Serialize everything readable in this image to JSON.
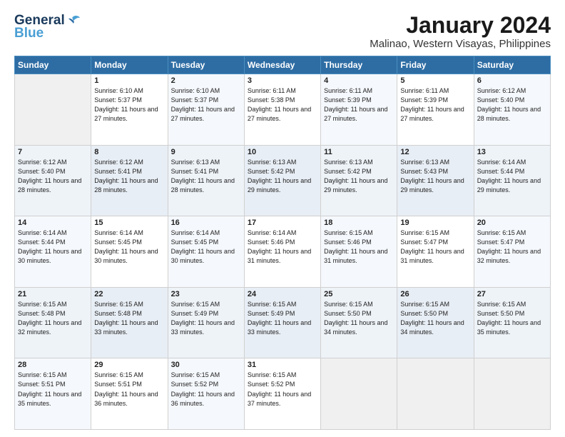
{
  "logo": {
    "line1": "General",
    "line2": "Blue"
  },
  "title": "January 2024",
  "subtitle": "Malinao, Western Visayas, Philippines",
  "weekdays": [
    "Sunday",
    "Monday",
    "Tuesday",
    "Wednesday",
    "Thursday",
    "Friday",
    "Saturday"
  ],
  "weeks": [
    [
      {
        "day": "",
        "sunrise": "",
        "sunset": "",
        "daylight": ""
      },
      {
        "day": "1",
        "sunrise": "6:10 AM",
        "sunset": "5:37 PM",
        "daylight": "11 hours and 27 minutes."
      },
      {
        "day": "2",
        "sunrise": "6:10 AM",
        "sunset": "5:37 PM",
        "daylight": "11 hours and 27 minutes."
      },
      {
        "day": "3",
        "sunrise": "6:11 AM",
        "sunset": "5:38 PM",
        "daylight": "11 hours and 27 minutes."
      },
      {
        "day": "4",
        "sunrise": "6:11 AM",
        "sunset": "5:39 PM",
        "daylight": "11 hours and 27 minutes."
      },
      {
        "day": "5",
        "sunrise": "6:11 AM",
        "sunset": "5:39 PM",
        "daylight": "11 hours and 27 minutes."
      },
      {
        "day": "6",
        "sunrise": "6:12 AM",
        "sunset": "5:40 PM",
        "daylight": "11 hours and 28 minutes."
      }
    ],
    [
      {
        "day": "7",
        "sunrise": "6:12 AM",
        "sunset": "5:40 PM",
        "daylight": "11 hours and 28 minutes."
      },
      {
        "day": "8",
        "sunrise": "6:12 AM",
        "sunset": "5:41 PM",
        "daylight": "11 hours and 28 minutes."
      },
      {
        "day": "9",
        "sunrise": "6:13 AM",
        "sunset": "5:41 PM",
        "daylight": "11 hours and 28 minutes."
      },
      {
        "day": "10",
        "sunrise": "6:13 AM",
        "sunset": "5:42 PM",
        "daylight": "11 hours and 29 minutes."
      },
      {
        "day": "11",
        "sunrise": "6:13 AM",
        "sunset": "5:42 PM",
        "daylight": "11 hours and 29 minutes."
      },
      {
        "day": "12",
        "sunrise": "6:13 AM",
        "sunset": "5:43 PM",
        "daylight": "11 hours and 29 minutes."
      },
      {
        "day": "13",
        "sunrise": "6:14 AM",
        "sunset": "5:44 PM",
        "daylight": "11 hours and 29 minutes."
      }
    ],
    [
      {
        "day": "14",
        "sunrise": "6:14 AM",
        "sunset": "5:44 PM",
        "daylight": "11 hours and 30 minutes."
      },
      {
        "day": "15",
        "sunrise": "6:14 AM",
        "sunset": "5:45 PM",
        "daylight": "11 hours and 30 minutes."
      },
      {
        "day": "16",
        "sunrise": "6:14 AM",
        "sunset": "5:45 PM",
        "daylight": "11 hours and 30 minutes."
      },
      {
        "day": "17",
        "sunrise": "6:14 AM",
        "sunset": "5:46 PM",
        "daylight": "11 hours and 31 minutes."
      },
      {
        "day": "18",
        "sunrise": "6:15 AM",
        "sunset": "5:46 PM",
        "daylight": "11 hours and 31 minutes."
      },
      {
        "day": "19",
        "sunrise": "6:15 AM",
        "sunset": "5:47 PM",
        "daylight": "11 hours and 31 minutes."
      },
      {
        "day": "20",
        "sunrise": "6:15 AM",
        "sunset": "5:47 PM",
        "daylight": "11 hours and 32 minutes."
      }
    ],
    [
      {
        "day": "21",
        "sunrise": "6:15 AM",
        "sunset": "5:48 PM",
        "daylight": "11 hours and 32 minutes."
      },
      {
        "day": "22",
        "sunrise": "6:15 AM",
        "sunset": "5:48 PM",
        "daylight": "11 hours and 33 minutes."
      },
      {
        "day": "23",
        "sunrise": "6:15 AM",
        "sunset": "5:49 PM",
        "daylight": "11 hours and 33 minutes."
      },
      {
        "day": "24",
        "sunrise": "6:15 AM",
        "sunset": "5:49 PM",
        "daylight": "11 hours and 33 minutes."
      },
      {
        "day": "25",
        "sunrise": "6:15 AM",
        "sunset": "5:50 PM",
        "daylight": "11 hours and 34 minutes."
      },
      {
        "day": "26",
        "sunrise": "6:15 AM",
        "sunset": "5:50 PM",
        "daylight": "11 hours and 34 minutes."
      },
      {
        "day": "27",
        "sunrise": "6:15 AM",
        "sunset": "5:50 PM",
        "daylight": "11 hours and 35 minutes."
      }
    ],
    [
      {
        "day": "28",
        "sunrise": "6:15 AM",
        "sunset": "5:51 PM",
        "daylight": "11 hours and 35 minutes."
      },
      {
        "day": "29",
        "sunrise": "6:15 AM",
        "sunset": "5:51 PM",
        "daylight": "11 hours and 36 minutes."
      },
      {
        "day": "30",
        "sunrise": "6:15 AM",
        "sunset": "5:52 PM",
        "daylight": "11 hours and 36 minutes."
      },
      {
        "day": "31",
        "sunrise": "6:15 AM",
        "sunset": "5:52 PM",
        "daylight": "11 hours and 37 minutes."
      },
      {
        "day": "",
        "sunrise": "",
        "sunset": "",
        "daylight": ""
      },
      {
        "day": "",
        "sunrise": "",
        "sunset": "",
        "daylight": ""
      },
      {
        "day": "",
        "sunrise": "",
        "sunset": "",
        "daylight": ""
      }
    ]
  ]
}
